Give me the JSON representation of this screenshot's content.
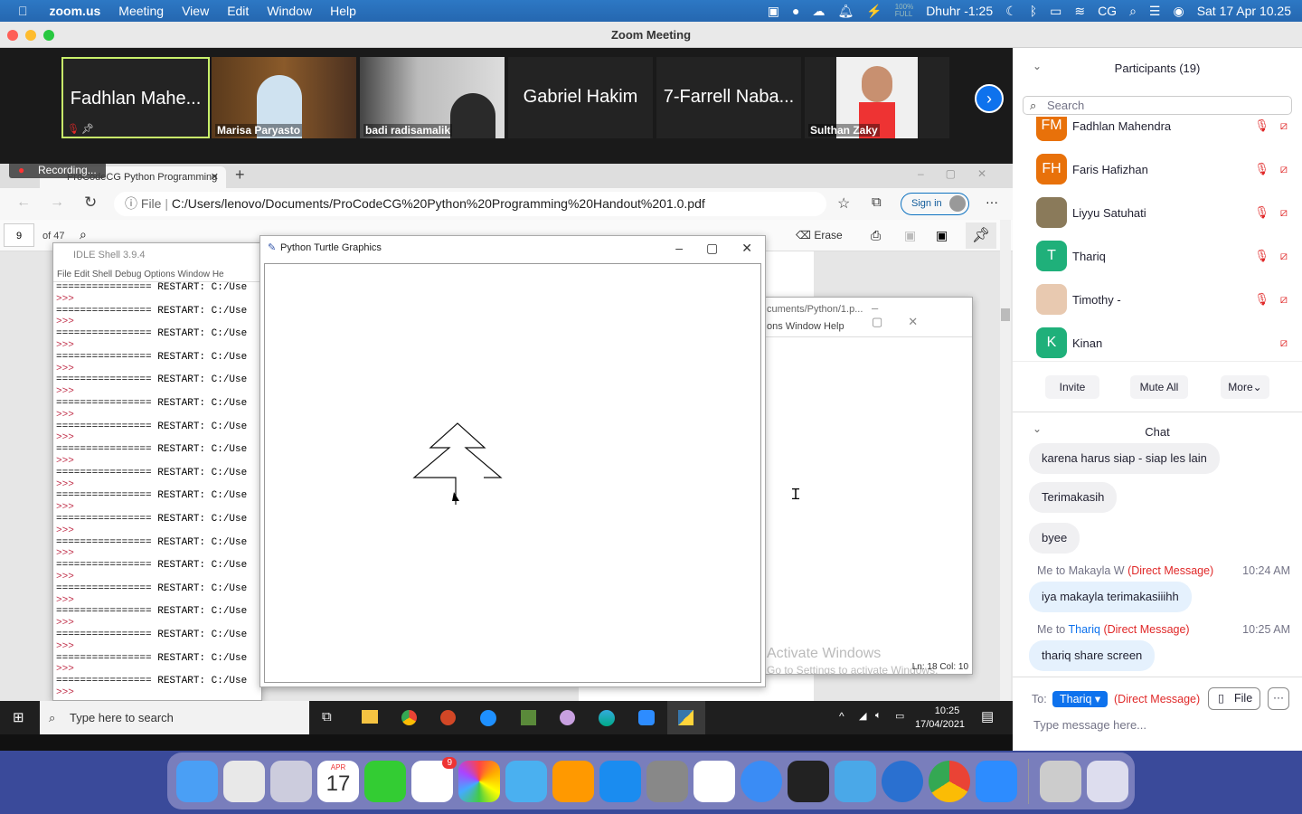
{
  "menubar": {
    "app": "zoom.us",
    "items": [
      "Meeting",
      "View",
      "Edit",
      "Window",
      "Help"
    ],
    "battery_pct": "100%",
    "battery_state": "FULL",
    "prayer": "Dhuhr -1:25",
    "input": "CG",
    "datetime": "Sat 17 Apr  10.25"
  },
  "window": {
    "title": "Zoom Meeting"
  },
  "videos": [
    {
      "name": "Fadhlan Mahe...",
      "active": true
    },
    {
      "name": "Marisa Paryasto"
    },
    {
      "name": "badi radisamalik"
    },
    {
      "name": "Gabriel Hakim"
    },
    {
      "name": "7-Farrell Naba..."
    },
    {
      "name": "Sulthan Zaky"
    }
  ],
  "recording": "Recording...",
  "browser": {
    "tab": "ProCodeCG Python Programming",
    "file_label": "File",
    "url": "C:/Users/lenovo/Documents/ProCodeCG%20Python%20Programming%20Handout%201.0.pdf",
    "sign_in": "Sign in",
    "page": "9",
    "of_pages": "of 47",
    "erase": "Erase"
  },
  "idle": {
    "title": "IDLE Shell 3.9.4",
    "menu": [
      "File",
      "Edit",
      "Shell",
      "Debug",
      "Options",
      "Window",
      "He"
    ],
    "restart_line": "================ RESTART: C:/Use",
    "prompt": ">>>"
  },
  "turtle": {
    "title": "Python Turtle Graphics"
  },
  "editor": {
    "title": "cuments/Python/1.p...",
    "menu": "ons  Window  Help",
    "status": "Ln: 18  Col: 10",
    "activate1": "Activate Windows",
    "activate2": "Go to Settings to activate Windows."
  },
  "taskbar": {
    "search": "Type here to search",
    "time": "10:25",
    "date": "17/04/2021"
  },
  "participants": {
    "title": "Participants (19)",
    "search_placeholder": "Search",
    "list": [
      {
        "initials": "FM",
        "name": "Fadhlan Mahendra",
        "color": "#e8710a"
      },
      {
        "initials": "FH",
        "name": "Faris Hafizhan",
        "color": "#e8710a"
      },
      {
        "initials": "",
        "name": "Liyyu Satuhati",
        "color": "#8a7a5a"
      },
      {
        "initials": "T",
        "name": "Thariq",
        "color": "#1fb07a"
      },
      {
        "initials": "",
        "name": "Timothy -",
        "color": "#e8c9b0"
      },
      {
        "initials": "K",
        "name": "Kinan",
        "color": "#1fb07a"
      }
    ],
    "invite": "Invite",
    "mute_all": "Mute All",
    "more": "More"
  },
  "chat": {
    "title": "Chat",
    "messages": [
      {
        "text": "karena harus siap - siap les lain"
      },
      {
        "text": "Terimakasih"
      },
      {
        "text": "byee"
      },
      {
        "from": "Me to ",
        "to": "Makayla W",
        "dm": "(Direct Message)",
        "time": "10:24 AM",
        "text": "iya makayla terimakasiiihh"
      },
      {
        "from": "Me to ",
        "to": "Thariq",
        "dm": "(Direct Message)",
        "time": "10:25 AM",
        "text": "thariq share screen"
      }
    ],
    "to_label": "To:",
    "to_value": "Thariq",
    "to_dm": "(Direct Message)",
    "file": "File",
    "placeholder": "Type message here..."
  },
  "dock": {
    "calendar_month": "APR",
    "calendar_day": "17",
    "reminders_badge": "9"
  }
}
